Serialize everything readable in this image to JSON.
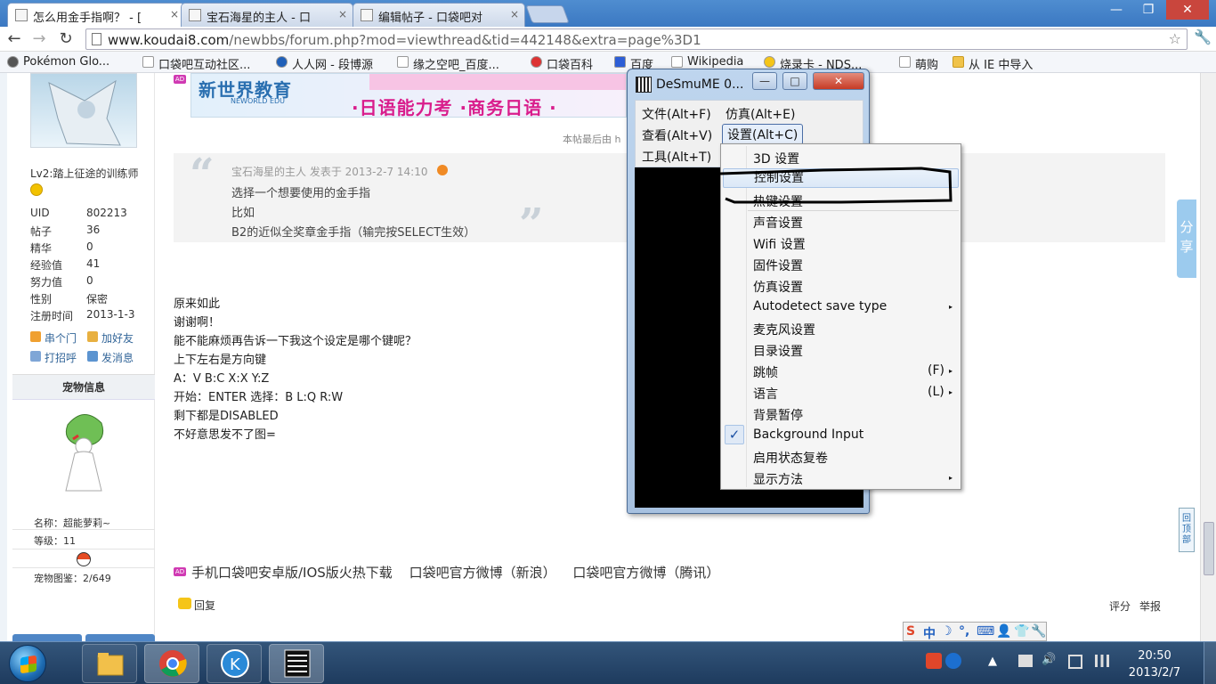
{
  "browser": {
    "tabs": [
      {
        "title": "怎么用金手指啊？ - [",
        "active": true
      },
      {
        "title": "宝石海星的主人 - 口",
        "active": false
      },
      {
        "title": "编辑帖子 - 口袋吧对",
        "active": false
      }
    ],
    "tab_close": "×",
    "window_controls": {
      "minimize": "—",
      "maximize": "❐",
      "close": "✕"
    },
    "nav": {
      "back": "←",
      "forward": "→",
      "reload": "↻"
    },
    "url_host": "www.koudai8.com",
    "url_path": "/newbbs/forum.php?mod=viewthread&tid=442148&extra=page%3D1",
    "star": "☆",
    "wrench": "🔧",
    "bookmarks": [
      "Pokémon Glo...",
      "口袋吧互动社区...",
      "人人网 - 段博源",
      "缘之空吧_百度...",
      "口袋百科",
      "百度",
      "Wikipedia",
      "烧录卡 - NDS...",
      "萌购",
      "从 IE 中导入"
    ]
  },
  "profile": {
    "level": "Lv2:踏上征途的训练师",
    "stats": [
      {
        "label": "UID",
        "value": "802213"
      },
      {
        "label": "帖子",
        "value": "36"
      },
      {
        "label": "精华",
        "value": "0"
      },
      {
        "label": "经验值",
        "value": "41"
      },
      {
        "label": "努力值",
        "value": "0"
      },
      {
        "label": "性别",
        "value": "保密"
      },
      {
        "label": "注册时间",
        "value": "2013-1-3"
      }
    ],
    "actions": [
      "串个门",
      "加好友",
      "打招呼",
      "发消息"
    ],
    "pet": {
      "title": "宠物信息",
      "name": "名称：超能萝莉~",
      "level": "等级：11",
      "dex": "宠物图鉴：2/649"
    }
  },
  "post": {
    "ad_label": "AD",
    "banner": {
      "logo": "新世界教育",
      "logo_sub": "NEWORLD EDU",
      "slogan": "·日语能力考 ·商务日语 ·"
    },
    "edit_note": "本帖最后由 h",
    "quote": {
      "author": "宝石海星的主人 发表于 2013-2-7 14:10",
      "lines": [
        "选择一个想要使用的金手指",
        "比如",
        "B2的近似全奖章金手指（输完按SELECT生效）"
      ]
    },
    "body_lines": [
      "原来如此",
      "谢谢啊！",
      "能不能麻烦再告诉一下我这个设定是哪个键呢？",
      "上下左右是方向键",
      "A：V B:C X:X Y:Z",
      "开始：ENTER 选择：B L:Q R:W",
      "剩下都是DISABLED",
      "不好意思发不了图="
    ],
    "footer_links": [
      "手机口袋吧安卓版/IOS版火热下载",
      "口袋吧官方微博（新浪）",
      "口袋吧官方微博（腾讯）"
    ],
    "reply": "回复",
    "rate": "评分",
    "report": "举报",
    "share": [
      "分",
      "享"
    ],
    "to_top": [
      "回",
      "顶",
      "部"
    ]
  },
  "desmume": {
    "title": "DeSmuME 0...",
    "controls": {
      "minimize": "—",
      "maximize": "□",
      "close": "✕"
    },
    "menus": [
      "文件(Alt+F)",
      "仿真(Alt+E)",
      "查看(Alt+V)",
      "设置(Alt+C)",
      "工具(Alt+T)"
    ],
    "settings_menu": [
      {
        "label": "3D 设置"
      },
      {
        "label": "控制设置",
        "highlighted": true
      },
      {
        "label": "热键设置"
      },
      {
        "label": "声音设置"
      },
      {
        "label": "Wifi 设置"
      },
      {
        "label": "固件设置"
      },
      {
        "label": "仿真设置"
      },
      {
        "label": "Autodetect save type",
        "submenu": true
      },
      {
        "label": "麦克风设置"
      },
      {
        "label": "目录设置"
      },
      {
        "label": "跳帧",
        "accel": "(F)",
        "submenu": true
      },
      {
        "label": "语言",
        "accel": "(L)",
        "submenu": true
      },
      {
        "label": "背景暂停"
      },
      {
        "label": "Background Input",
        "checked": true
      },
      {
        "label": "启用状态复卷"
      },
      {
        "label": "显示方法",
        "submenu": true
      }
    ],
    "submenu_arrow": "▸",
    "checkmark": "✓"
  },
  "ime": [
    "S",
    "中",
    "☽",
    "°,",
    "⌨",
    "👤",
    "👕",
    "🔧"
  ],
  "taskbar": {
    "tray": [
      "▲",
      "🔊"
    ],
    "time": "20:50",
    "date": "2013/2/7",
    "desmume_icon_text": "DeSmuME"
  },
  "colors": {
    "accent": "#3b78c2",
    "highlight": "#dbe8f7",
    "annotation": "#000000"
  }
}
